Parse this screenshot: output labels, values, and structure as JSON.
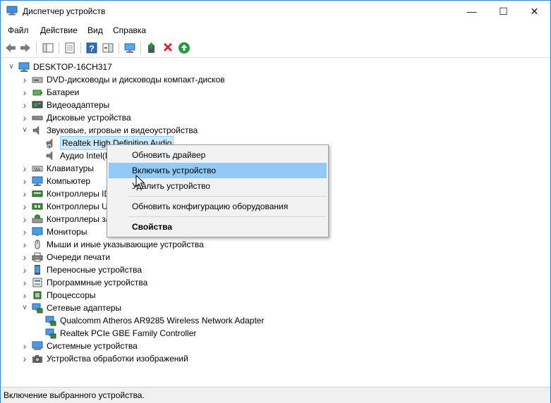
{
  "window": {
    "title": "Диспетчер устройств",
    "minimize": "—",
    "maximize": "☐",
    "close": "✕"
  },
  "menu": [
    "Файл",
    "Действие",
    "Вид",
    "Справка"
  ],
  "tree": {
    "root": "DESKTOP-16CH317",
    "items": [
      {
        "label": "DVD-дисководы и дисководы компакт-дисков",
        "icon": "dvd-drive-icon",
        "expanded": false
      },
      {
        "label": "Батареи",
        "icon": "battery-icon",
        "expanded": false
      },
      {
        "label": "Видеоадаптеры",
        "icon": "display-adapter-icon",
        "expanded": false
      },
      {
        "label": "Дисковые устройства",
        "icon": "disk-drive-icon",
        "expanded": false
      },
      {
        "label": "Звуковые, игровые и видеоустройства",
        "icon": "speaker-icon",
        "expanded": true,
        "children": [
          {
            "label": "Realtek High Definition Audio",
            "icon": "speaker-disabled-icon",
            "selected": true
          },
          {
            "label": "Аудио Intel(R",
            "icon": "speaker-icon"
          }
        ]
      },
      {
        "label": "Клавиатуры",
        "icon": "keyboard-icon",
        "expanded": false
      },
      {
        "label": "Компьютер",
        "icon": "computer-icon",
        "expanded": false
      },
      {
        "label": "Контроллеры ID",
        "icon": "ide-controller-icon",
        "expanded": false
      },
      {
        "label": "Контроллеры U",
        "icon": "usb-controller-icon",
        "expanded": false
      },
      {
        "label": "Контроллеры за",
        "icon": "storage-controller-icon",
        "expanded": false
      },
      {
        "label": "Мониторы",
        "icon": "monitor-icon",
        "expanded": false
      },
      {
        "label": "Мыши и иные указывающие устройства",
        "icon": "mouse-icon",
        "expanded": false
      },
      {
        "label": "Очереди печати",
        "icon": "printer-icon",
        "expanded": false
      },
      {
        "label": "Переносные устройства",
        "icon": "portable-device-icon",
        "expanded": false
      },
      {
        "label": "Программные устройства",
        "icon": "software-device-icon",
        "expanded": false
      },
      {
        "label": "Процессоры",
        "icon": "processor-icon",
        "expanded": false
      },
      {
        "label": "Сетевые адаптеры",
        "icon": "network-adapter-icon",
        "expanded": true,
        "children": [
          {
            "label": "Qualcomm Atheros AR9285 Wireless Network Adapter",
            "icon": "network-adapter-icon"
          },
          {
            "label": "Realtek PCIe GBE Family Controller",
            "icon": "network-adapter-icon"
          }
        ]
      },
      {
        "label": "Системные устройства",
        "icon": "system-device-icon",
        "expanded": false
      },
      {
        "label": "Устройства обработки изображений",
        "icon": "camera-icon",
        "expanded": false
      }
    ]
  },
  "context_menu": {
    "update_driver": "Обновить драйвер",
    "enable_device": "Включить устройство",
    "uninstall_device": "Удалить устройство",
    "scan_hardware": "Обновить конфигурацию оборудования",
    "properties": "Свойства"
  },
  "status": "Включение выбранного устройства.",
  "colors": {
    "accent": "#2b7fd6",
    "highlight": "#91c9f7",
    "selection": "#cce8ff",
    "enable_green": "#1e9e3a",
    "remove_red": "#d6262d"
  }
}
